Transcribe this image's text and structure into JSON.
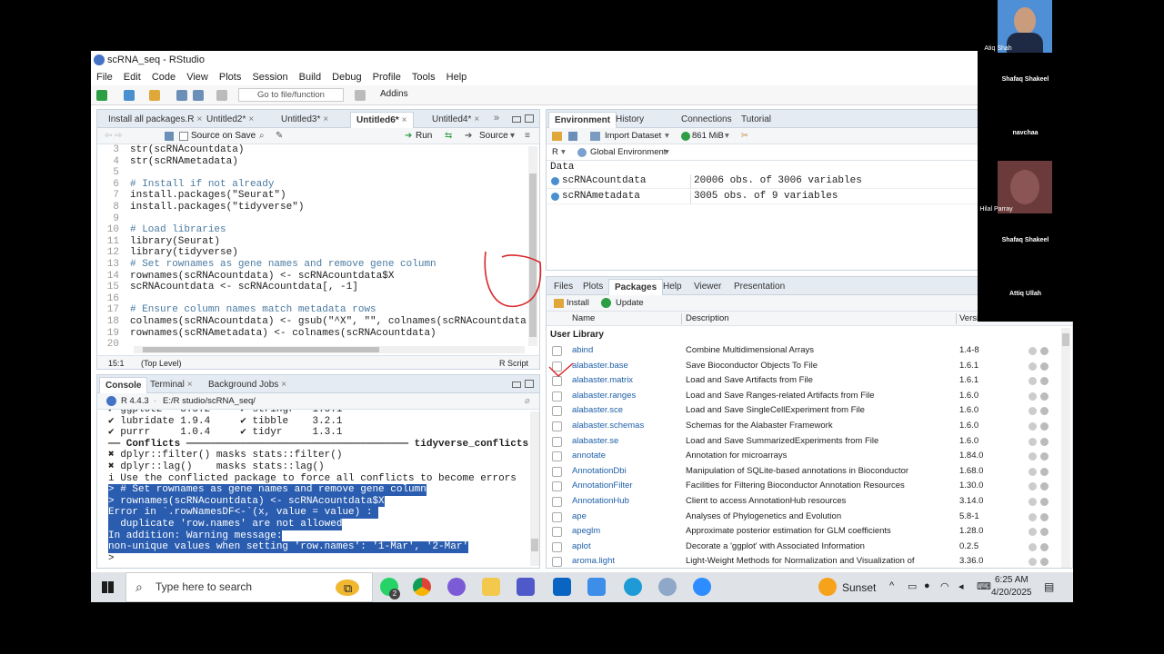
{
  "window": {
    "title": "scRNA_seq - RStudio"
  },
  "menu": [
    "File",
    "Edit",
    "Code",
    "View",
    "Plots",
    "Session",
    "Build",
    "Debug",
    "Profile",
    "Tools",
    "Help"
  ],
  "toolbar": {
    "goto_placeholder": "Go to file/function",
    "addins": "Addins"
  },
  "editor": {
    "tabs": [
      "Install all packages.R",
      "Untitled2*",
      "Untitled3*",
      "Untitled6*",
      "Untitled4*"
    ],
    "active_tab": 3,
    "source_on_save": "Source on Save",
    "run": "Run",
    "source": "Source",
    "lines": [
      {
        "n": "3",
        "t": "str(scRNAcountdata)",
        "k": "code"
      },
      {
        "n": "4",
        "t": "str(scRNAmetadata)",
        "k": "code"
      },
      {
        "n": "5",
        "t": "",
        "k": "code"
      },
      {
        "n": "6",
        "t": "# Install if not already",
        "k": "cm"
      },
      {
        "n": "7",
        "t": "install.packages(\"Seurat\")",
        "k": "code"
      },
      {
        "n": "8",
        "t": "install.packages(\"tidyverse\")",
        "k": "code"
      },
      {
        "n": "9",
        "t": "",
        "k": "code"
      },
      {
        "n": "10",
        "t": "# Load libraries",
        "k": "cm"
      },
      {
        "n": "11",
        "t": "library(Seurat)",
        "k": "code"
      },
      {
        "n": "12",
        "t": "library(tidyverse)",
        "k": "code"
      },
      {
        "n": "13",
        "t": "# Set rownames as gene names and remove gene column",
        "k": "cm"
      },
      {
        "n": "14",
        "t": "rownames(scRNAcountdata) <- scRNAcountdata$X",
        "k": "code"
      },
      {
        "n": "15",
        "t": "scRNAcountdata <- scRNAcountdata[, -1]",
        "k": "code"
      },
      {
        "n": "16",
        "t": "",
        "k": "code"
      },
      {
        "n": "17",
        "t": "# Ensure column names match metadata rows",
        "k": "cm"
      },
      {
        "n": "18",
        "t": "colnames(scRNAcountdata) <- gsub(\"^X\", \"\", colnames(scRNAcountdata))",
        "k": "code"
      },
      {
        "n": "19",
        "t": "rownames(scRNAmetadata) <- colnames(scRNAcountdata)",
        "k": "code"
      },
      {
        "n": "20",
        "t": "",
        "k": "code"
      }
    ],
    "status_pos": "15:1",
    "status_level": "(Top Level)",
    "status_type": "R Script"
  },
  "console": {
    "tabs": [
      "Console",
      "Terminal",
      "Background Jobs"
    ],
    "version": "R 4.4.3",
    "path": "E:/R studio/scRNA_seq/",
    "lines": [
      {
        "t": "✔ ggplot2   3.5.2     ✔ stringr   1.5.1",
        "k": "plain"
      },
      {
        "t": "✔ lubridate 1.9.4     ✔ tibble    3.2.1",
        "k": "plain"
      },
      {
        "t": "✔ purrr     1.0.4     ✔ tidyr     1.3.1",
        "k": "plain"
      },
      {
        "t": "—— Conflicts ————————————————————————————————————— tidyverse_conflicts() ——",
        "k": "bold"
      },
      {
        "t": "✖ dplyr::filter() masks stats::filter()",
        "k": "plain"
      },
      {
        "t": "✖ dplyr::lag()    masks stats::lag()",
        "k": "plain"
      },
      {
        "t": "i Use the conflicted package to force all conflicts to become errors",
        "k": "plain"
      },
      {
        "t": "> # Set rownames as gene names and remove gene column",
        "k": "sel"
      },
      {
        "t": "> rownames(scRNAcountdata) <- scRNAcountdata$X",
        "k": "sel"
      },
      {
        "t": "Error in `.rowNamesDF<-`(x, value = value) : ",
        "k": "sel"
      },
      {
        "t": "  duplicate 'row.names' are not allowed",
        "k": "sel"
      },
      {
        "t": "In addition: Warning message:",
        "k": "sel"
      },
      {
        "t": "non-unique values when setting 'row.names': '1-Mar', '2-Mar'",
        "k": "sel"
      },
      {
        "t": "> ",
        "k": "plain"
      }
    ]
  },
  "environment": {
    "tabs": [
      "Environment",
      "History",
      "Connections",
      "Tutorial"
    ],
    "import_dataset": "Import Dataset",
    "memory": "861 MiB",
    "lang": "R",
    "scope": "Global Environment",
    "section": "Data",
    "rows": [
      {
        "name": "scRNAcountdata",
        "value": "20006 obs. of 3006 variables"
      },
      {
        "name": "scRNAmetadata",
        "value": "3005 obs. of 9 variables"
      }
    ]
  },
  "files": {
    "tabs": [
      "Files",
      "Plots",
      "Packages",
      "Help",
      "Viewer",
      "Presentation"
    ],
    "install": "Install",
    "update": "Update",
    "col_name": "Name",
    "col_desc": "Description",
    "col_ver": "Versi",
    "section": "User Library",
    "packages": [
      {
        "name": "abind",
        "desc": "Combine Multidimensional Arrays",
        "ver": "1.4-8"
      },
      {
        "name": "alabaster.base",
        "desc": "Save Bioconductor Objects To File",
        "ver": "1.6.1"
      },
      {
        "name": "alabaster.matrix",
        "desc": "Load and Save Artifacts from File",
        "ver": "1.6.1"
      },
      {
        "name": "alabaster.ranges",
        "desc": "Load and Save Ranges-related Artifacts from File",
        "ver": "1.6.0"
      },
      {
        "name": "alabaster.sce",
        "desc": "Load and Save SingleCellExperiment from File",
        "ver": "1.6.0"
      },
      {
        "name": "alabaster.schemas",
        "desc": "Schemas for the Alabaster Framework",
        "ver": "1.6.0"
      },
      {
        "name": "alabaster.se",
        "desc": "Load and Save SummarizedExperiments from File",
        "ver": "1.6.0"
      },
      {
        "name": "annotate",
        "desc": "Annotation for microarrays",
        "ver": "1.84.0"
      },
      {
        "name": "AnnotationDbi",
        "desc": "Manipulation of SQLite-based annotations in Bioconductor",
        "ver": "1.68.0"
      },
      {
        "name": "AnnotationFilter",
        "desc": "Facilities for Filtering Bioconductor Annotation Resources",
        "ver": "1.30.0"
      },
      {
        "name": "AnnotationHub",
        "desc": "Client to access AnnotationHub resources",
        "ver": "3.14.0"
      },
      {
        "name": "ape",
        "desc": "Analyses of Phylogenetics and Evolution",
        "ver": "5.8-1"
      },
      {
        "name": "apeglm",
        "desc": "Approximate posterior estimation for GLM coefficients",
        "ver": "1.28.0"
      },
      {
        "name": "aplot",
        "desc": "Decorate a 'ggplot' with Associated Information",
        "ver": "0.2.5"
      },
      {
        "name": "aroma.light",
        "desc": "Light-Weight Methods for Normalization and Visualization of",
        "ver": "3.36.0"
      }
    ]
  },
  "taskbar": {
    "search": "Type here to search",
    "weather": "Sunset",
    "time": "6:25 AM",
    "date": "4/20/2025",
    "whatsapp_badge": "2"
  },
  "meeting": {
    "participants": [
      "Atiq Shah",
      "Shafaq Shakeel",
      "navchaa",
      "Hilal Parray",
      "Shafaq Shakeel",
      "Attiq Ullah"
    ]
  }
}
